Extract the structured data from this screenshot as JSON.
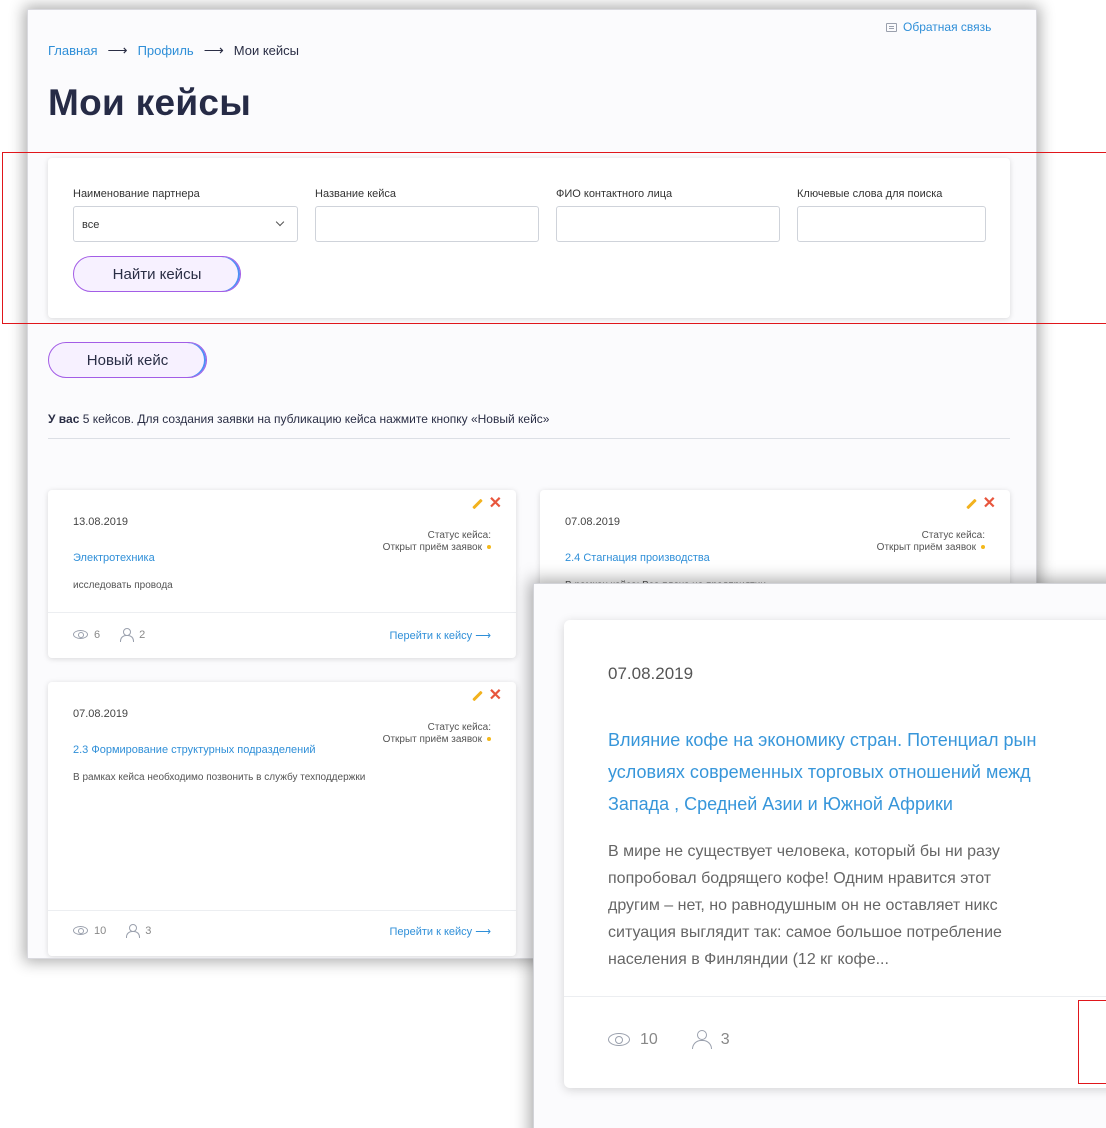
{
  "header": {
    "feedback_label": "Обратная связь",
    "breadcrumb": [
      "Главная",
      "Профиль",
      "Мои кейсы"
    ],
    "breadcrumb_separator": "⟶",
    "title": "Мои кейсы"
  },
  "filters": {
    "partner_label": "Наименование партнера",
    "partner_selected": "все",
    "case_name_label": "Название кейса",
    "contact_label": "ФИО контактного лица",
    "keywords_label": "Ключевые слова для поиска",
    "search_button": "Найти кейсы"
  },
  "new_case_button": "Новый кейс",
  "summary": {
    "prefix": "У вас",
    "text": " 5 кейсов. Для создания заявки на публикацию кейса нажмите кнопку «Новый кейс»"
  },
  "cards": [
    {
      "date": "13.08.2019",
      "status_label": "Статус кейса:",
      "status": "Открыт приём заявок",
      "title": "Электротехника",
      "description": "исследовать провода",
      "views": "6",
      "participants": "2",
      "link": "Перейти к кейсу ⟶"
    },
    {
      "date": "07.08.2019",
      "status_label": "Статус кейса:",
      "status": "Открыт приём заявок",
      "title": "2.4 Стагнация производства",
      "description": "В рамках кейса: Все плохо на предприятии"
    },
    {
      "date": "07.08.2019",
      "status_label": "Статус кейса:",
      "status": "Открыт приём заявок",
      "title": "2.3 Формирование структурных подразделений",
      "description": "В рамках кейса необходимо позвонить в службу техподдержки",
      "views": "10",
      "participants": "3",
      "link": "Перейти к кейсу ⟶"
    }
  ],
  "zoom_card": {
    "date": "07.08.2019",
    "title": "Влияние кофе на экономику стран. Потенциал рын\nусловиях современных торговых отношений межд\nЗапада , Средней Азии и Южной Африки",
    "description": "В мире не существует человека, который бы ни разу\nпопробовал бодрящего кофе! Одним нравится этот\nдругим – нет, но равнодушным он не оставляет никс\nситуация выглядит так: самое большое потребление\nнаселения в Финляндии (12 кг кофе...",
    "views": "10",
    "participants": "3"
  },
  "colors": {
    "link": "#2f8fd8",
    "title": "#262b46",
    "highlight": "#e0161b",
    "status_dot": "#f4b81a",
    "delete": "#e8563d",
    "edit": "#f2b21e",
    "button_border": "#a35de6"
  }
}
